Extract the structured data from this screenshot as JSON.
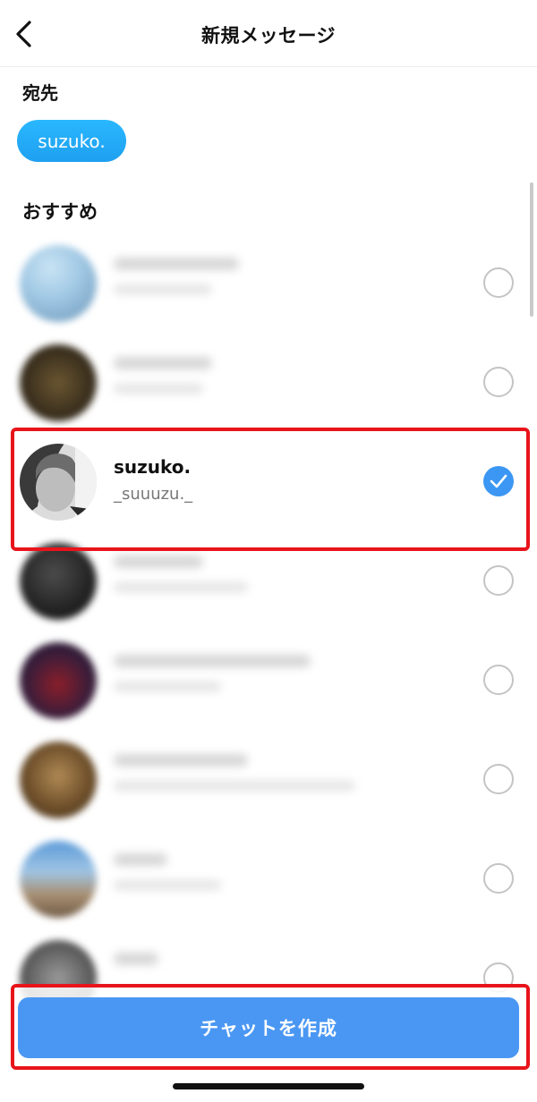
{
  "header": {
    "title": "新規メッセージ"
  },
  "to": {
    "label": "宛先",
    "chip": "suzuko."
  },
  "suggestions": {
    "label": "おすすめ",
    "selected_user": {
      "name": "suzuko.",
      "handle": "_suuuzu._"
    }
  },
  "create_button": {
    "label": "チャットを作成"
  },
  "colors": {
    "accent": "#3b97f3",
    "chip": "#1ea0f0",
    "highlight": "#e8141b"
  }
}
